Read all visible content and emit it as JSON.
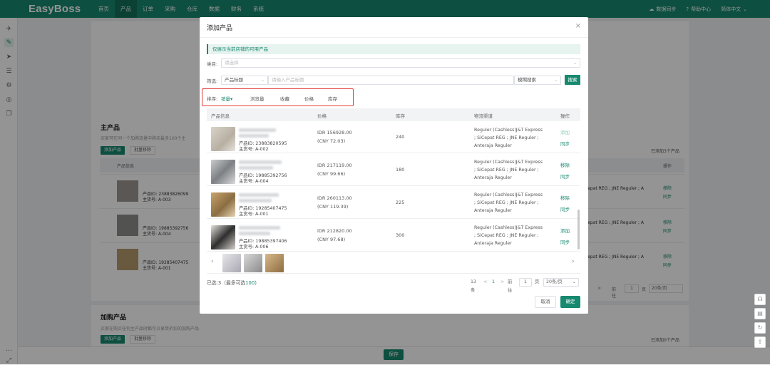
{
  "topbar": {
    "logo": "EasyBoss",
    "nav": [
      "首页",
      "产品",
      "订单",
      "采购",
      "仓库",
      "数据",
      "财务",
      "系统"
    ],
    "active_nav": "产品",
    "right": [
      "数据同步",
      "帮助中心",
      "简体中文"
    ]
  },
  "colors": {
    "brand": "#17896f",
    "highlight_box": "#e23a3a"
  },
  "background": {
    "main_title": "主产品",
    "main_sub": "买家可在同一个加购流量中购买最多100个主",
    "add_btn": "添加产品",
    "clear_btn": "批量移除",
    "col_info": "产品信息",
    "col_op": "操作",
    "added_main": "已添加3个产品",
    "rows": [
      {
        "pid": "产品ID: 23883826099",
        "sku": "主货号: A-003",
        "logi": "Cepat REG ; JNE Reguler ; A",
        "op1": "移除",
        "op2": "同步"
      },
      {
        "pid": "产品ID: 19885392756",
        "sku": "主货号: A-004",
        "logi": "Cepat REG ; JNE Reguler ; A",
        "op1": "移除",
        "op2": "同步"
      },
      {
        "pid": "产品ID: 19285407475",
        "sku": "主货号: A-001",
        "logi": "Cepat REG ; JNE Reguler ; A",
        "op1": "移除",
        "op2": "同步"
      }
    ],
    "bg_pager": {
      "prev": "<",
      "next": ">",
      "goto": "前往",
      "page": "1",
      "unit": "页",
      "size": "20条/页"
    },
    "addon_title": "加购产品",
    "addon_sub": "买家在购买任何主产品时都可以享受折扣的加购产品",
    "added_addon": "已添加0个产品",
    "save": "保存"
  },
  "modal": {
    "title": "添加产品",
    "close": "×",
    "notice": "仅展示当前店铺的可用产品",
    "category_label": "类目:",
    "category_placeholder": "请选择",
    "filter_label": "筛选:",
    "filter_field": "产品标题",
    "filter_placeholder": "请输入产品标题",
    "match_mode": "模糊搜索",
    "search_btn": "搜索",
    "sort_label": "排序:",
    "sort_options": [
      "销量",
      "浏览量",
      "收藏",
      "价格",
      "库存"
    ],
    "sort_active": "销量",
    "columns": [
      "产品信息",
      "价格",
      "库存",
      "物流渠道",
      "操作"
    ],
    "rows": [
      {
        "pid": "产品ID: 23883820595",
        "sku": "主货号: A-002",
        "price_idr": "IDR 156928.00",
        "price_cny": "(CNY 72.03)",
        "stock": "240",
        "logistics": "Reguler (Cashless)J&T Express ; SiCepat REG ; JNE Reguler ; Anteraja Reguler",
        "op1": "添加",
        "op2": "同步",
        "op1_disabled": true
      },
      {
        "pid": "产品ID: 19885392756",
        "sku": "主货号: A-004",
        "price_idr": "IDR 217119.00",
        "price_cny": "(CNY 99.66)",
        "stock": "180",
        "logistics": "Reguler (Cashless)J&T Express ; SiCepat REG ; JNE Reguler ; Anteraja Reguler",
        "op1": "移除",
        "op2": "同步",
        "op1_disabled": false
      },
      {
        "pid": "产品ID: 19285407475",
        "sku": "主货号: A-001",
        "price_idr": "IDR 260113.00",
        "price_cny": "(CNY 119.39)",
        "stock": "225",
        "logistics": "Reguler (Cashless)J&T Express ; SiCepat REG ; JNE Reguler ; Anteraja Reguler",
        "op1": "移除",
        "op2": "同步",
        "op1_disabled": false
      },
      {
        "pid": "产品ID: 19885397406",
        "sku": "主货号: A-006",
        "price_idr": "IDR 212820.00",
        "price_cny": "(CNY 97.68)",
        "stock": "300",
        "logistics": "Reguler (Cashless)J&T Express ; SiCepat REG ; JNE Reguler ; Anteraja Reguler",
        "op1": "添加",
        "op2": "同步",
        "op1_disabled": false
      }
    ],
    "selected_label": "已选:3（最多可选",
    "selected_max": "100",
    "selected_end": "）",
    "pager": {
      "total": "13条",
      "prev": "<",
      "page": "1",
      "next": ">",
      "goto": "前往",
      "goto_page": "1",
      "unit": "页",
      "size": "20条/页"
    },
    "cancel": "取消",
    "confirm": "确定"
  }
}
